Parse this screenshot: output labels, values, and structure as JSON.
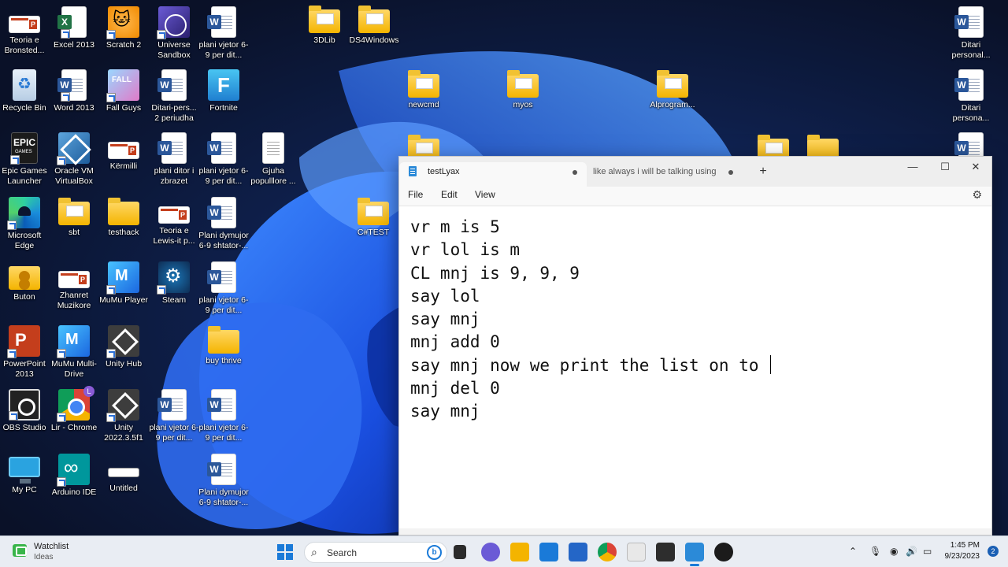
{
  "desktop": {
    "icons": {
      "teoria_bronsted": "Teoria e Bronsted...",
      "excel": "Excel 2013",
      "scratch": "Scratch 2",
      "universe_sandbox": "Universe Sandbox",
      "plani_vjetor_1": "plani vjetor 6-9 per dit...",
      "lib3d": "3DLib",
      "ds4windows": "DS4Windows",
      "ditari_personal_1": "Ditari personal...",
      "recycle_bin": "Recycle Bin",
      "word": "Word 2013",
      "fall_guys": "Fall Guys",
      "ditari_pers_2": "Ditari-pers... 2 periudha",
      "fortnite": "Fortnite",
      "newcmd": "newcmd",
      "myos": "myos",
      "alprogram": "Alprogram...",
      "ditari_persona_2": "Ditari persona...",
      "epic": "Epic Games Launcher",
      "virtualbox": "Oracle VM VirtualBox",
      "kermilli": "Kërmilli",
      "plani_ditor": "plani ditor i zbrazet",
      "plani_vjetor_2": "plani vjetor 6-9  per dit...",
      "gjuha": "Gjuha populllore ...",
      "edge": "Microsoft Edge",
      "sbt": "sbt",
      "testhack": "testhack",
      "teoria_lewis": "Teoria e Lewis-it p...",
      "plani_dymujor_1": "Plani dymujor 6-9 shtator-...",
      "csharp_test": "C#TEST",
      "buton": "Buton",
      "zhanret": "Zhanret Muzikore",
      "mumu_player": "MuMu Player",
      "steam": "Steam",
      "plani_vjetor_3": "plani vjetor 6-9 per dit...",
      "powerpoint": "PowerPoint 2013",
      "mumu_drive": "MuMu Multi-Drive",
      "unity_hub": "Unity Hub",
      "buy_thrive": "buy thrive",
      "obs": "OBS Studio",
      "lir_chrome": "Lir - Chrome",
      "unity_2022": "Unity 2022.3.5f1",
      "plani_vjetor_4": "plani vjetor 6-9 per dit...",
      "plani_vjetor_5": "plani  vjetor 6-9 per dit...",
      "my_pc": "My PC",
      "arduino": "Arduino IDE",
      "untitled": "Untitled",
      "plani_dymujor_2": "Plani dymujor 6-9 shtator-..."
    }
  },
  "notepad": {
    "tabs": [
      {
        "title": "testLyax"
      },
      {
        "title": "like always i will be talking using"
      }
    ],
    "new_tab": "+",
    "controls": {
      "minimize": "—",
      "maximize": "☐",
      "close": "✕"
    },
    "menu": {
      "file": "File",
      "edit": "Edit",
      "view": "View"
    },
    "settings_icon": "⚙",
    "lines": [
      "vr m is 5",
      "vr lol is m",
      "CL mnj is 9, 9, 9",
      "say lol",
      "say mnj",
      "mnj add 0",
      "say mnj now we print the list on to ",
      "mnj del 0",
      "say mnj"
    ]
  },
  "taskbar": {
    "widget": {
      "title": "Watchlist",
      "subtitle": "Ideas"
    },
    "search": {
      "placeholder": "Search",
      "bing": "b"
    },
    "clock": {
      "time": "1:45 PM",
      "date": "9/23/2023"
    },
    "notifications": "2",
    "tray": {
      "chevron": "⌃",
      "mic": "🎙",
      "wifi": "◉",
      "volume": "🔊",
      "battery": "▭"
    }
  },
  "colors": {
    "accent": "#1a7ad8",
    "wallpaper_dark": "#0b1530",
    "wallpaper_blue": "#1f5fe8"
  }
}
